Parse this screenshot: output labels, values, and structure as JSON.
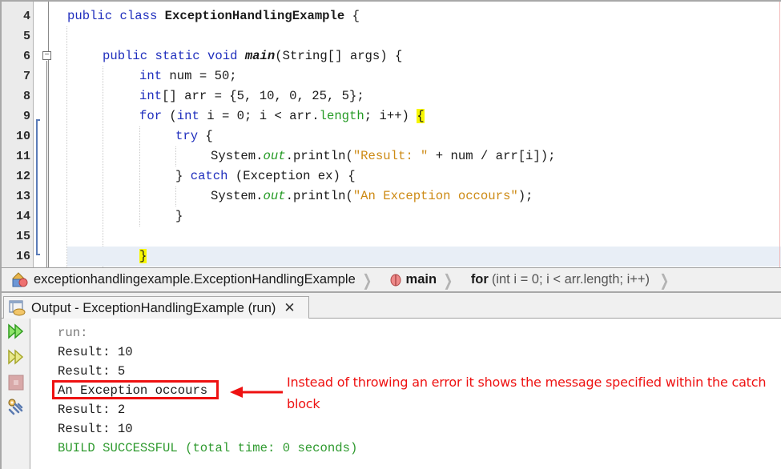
{
  "editor": {
    "line_numbers": [
      "4",
      "5",
      "6",
      "7",
      "8",
      "9",
      "10",
      "11",
      "12",
      "13",
      "14",
      "15",
      "16"
    ],
    "lines": {
      "l4": {
        "kw1": "public",
        "kw2": "class",
        "cls": "ExceptionHandlingExample",
        "rest": " {"
      },
      "l6": {
        "kw1": "public",
        "kw2": "static",
        "kw3": "void",
        "mth": "main",
        "rest": "(String[] args) {"
      },
      "l7": {
        "kw": "int",
        "rest": " num = 50;"
      },
      "l8": {
        "kw": "int",
        "rest": "[] arr = {5, 10, 0, 25, 5};"
      },
      "l9": {
        "kw1": "for",
        "p1": " (",
        "kw2": "int",
        "p2": " i = 0; i < arr.",
        "len": "length",
        "p3": "; i++) ",
        "brace": "{"
      },
      "l10": {
        "kw": "try",
        "rest": " {"
      },
      "l11": {
        "p1": "System.",
        "fld": "out",
        "p2": ".println(",
        "str": "\"Result: \"",
        "p3": " + num / arr[i]);"
      },
      "l12": {
        "p1": "} ",
        "kw": "catch",
        "p2": " (Exception ex) {"
      },
      "l13": {
        "p1": "System.",
        "fld": "out",
        "p2": ".println(",
        "str": "\"An Exception occours\"",
        "p3": ");"
      },
      "l14": {
        "text": "}"
      },
      "l16": {
        "brace": "}"
      }
    },
    "fold_toggle": "−"
  },
  "breadcrumb": {
    "items": [
      {
        "label": "exceptionhandlingexample.ExceptionHandlingExample",
        "icon": "class-icon"
      },
      {
        "label": "main",
        "icon": "method-icon"
      },
      {
        "keyword": "for",
        "detail": "(int i = 0; i < arr.length; i++)"
      }
    ],
    "separator": "❯"
  },
  "output": {
    "tab_title": "Output - ExceptionHandlingExample (run)",
    "close_label": "✕",
    "lines": [
      {
        "text": "run:",
        "type": "run"
      },
      {
        "text": "Result: 10",
        "type": "normal"
      },
      {
        "text": "Result: 5",
        "type": "normal"
      },
      {
        "text": "An Exception occours",
        "type": "normal"
      },
      {
        "text": "Result: 2",
        "type": "normal"
      },
      {
        "text": "Result: 10",
        "type": "normal"
      },
      {
        "text": "BUILD SUCCESSFUL (total time: 0 seconds)",
        "type": "success"
      }
    ],
    "toolbar": [
      "rerun-icon",
      "rerun-with-options-icon",
      "stop-icon",
      "settings-icon"
    ]
  },
  "annotation": {
    "text": "Instead of throwing an error it shows the message specified within the catch block",
    "color": "#ee1111"
  },
  "colors": {
    "keyword": "#1f2ebd",
    "string": "#cd8a14",
    "field": "#249a24",
    "success": "#2e9a2e",
    "brace_highlight": "#f7f700",
    "current_line": "#e8eef6"
  }
}
